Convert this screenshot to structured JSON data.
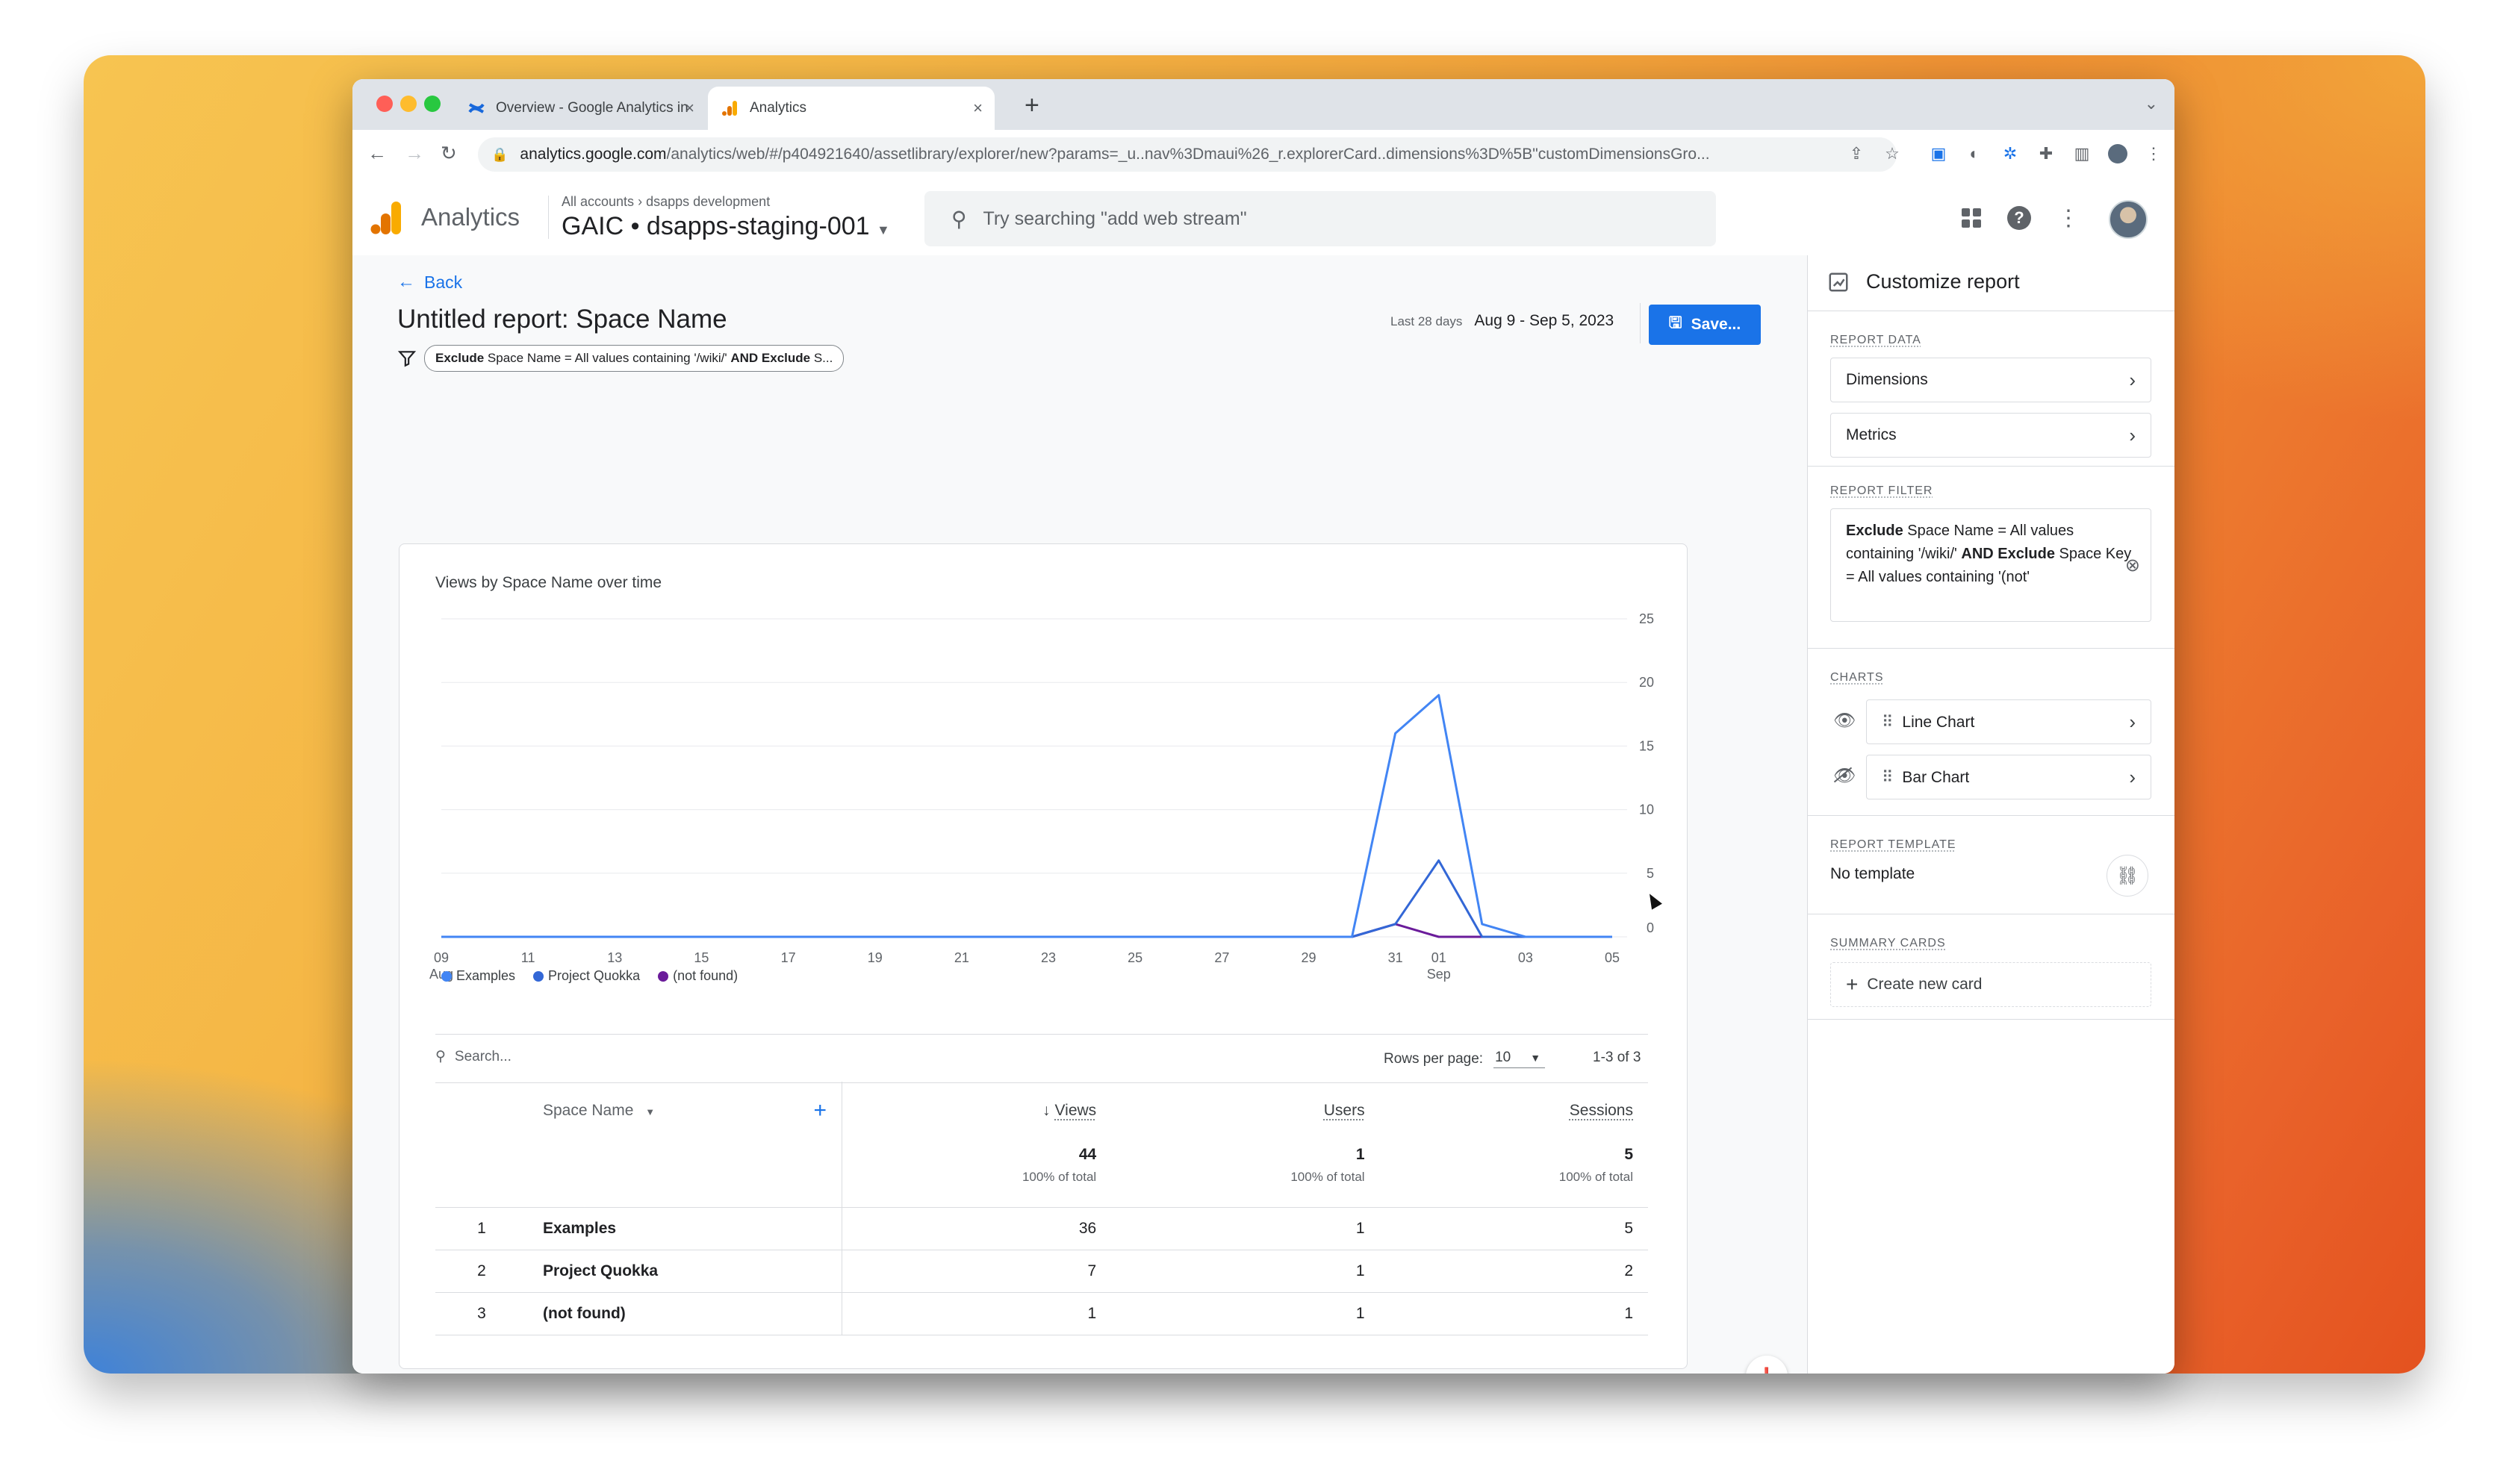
{
  "browser": {
    "tabs": [
      {
        "title": "Overview - Google Analytics in",
        "active": false
      },
      {
        "title": "Analytics",
        "active": true
      }
    ],
    "url_host": "analytics.google.com",
    "url_path": "/analytics/web/#/p404921640/assetlibrary/explorer/new?params=_u..nav%3Dmaui%26_r.explorerCard..dimensions%3D%5B\"customDimensionsGro..."
  },
  "header": {
    "app_name": "Analytics",
    "breadcrumb_root": "All accounts",
    "breadcrumb_account": "dsapps development",
    "property": "GAIC • dsapps-staging-001",
    "search_placeholder": "Try searching \"add web stream\""
  },
  "report": {
    "back_label": "Back",
    "title": "Untitled report: Space Name",
    "filter_chip": {
      "b1": "Exclude",
      "t1": " Space Name = All values containing '/wiki/' ",
      "b2": "AND Exclude",
      "t2": " S..."
    },
    "date_label": "Last 28 days",
    "date_value": "Aug 9 - Sep 5, 2023",
    "save_label": "Save..."
  },
  "chart_data": {
    "type": "line",
    "title": "Views by Space Name over time",
    "x": [
      "Aug 9",
      "Aug 10",
      "Aug 11",
      "Aug 12",
      "Aug 13",
      "Aug 14",
      "Aug 15",
      "Aug 16",
      "Aug 17",
      "Aug 18",
      "Aug 19",
      "Aug 20",
      "Aug 21",
      "Aug 22",
      "Aug 23",
      "Aug 24",
      "Aug 25",
      "Aug 26",
      "Aug 27",
      "Aug 28",
      "Aug 29",
      "Aug 30",
      "Aug 31",
      "Sep 1",
      "Sep 2",
      "Sep 3",
      "Sep 4",
      "Sep 5"
    ],
    "x_tick_labels": [
      "09",
      "11",
      "13",
      "15",
      "17",
      "19",
      "21",
      "23",
      "25",
      "27",
      "29",
      "31",
      "01",
      "03",
      "05"
    ],
    "x_tick_sublabels": {
      "09": "Aug",
      "01": "Sep"
    },
    "y_ticks": [
      0,
      5,
      10,
      15,
      20,
      25
    ],
    "ylim": [
      0,
      25
    ],
    "y_axis_side": "right",
    "grid": true,
    "legend_position": "bottom-left",
    "series": [
      {
        "name": "Examples",
        "color": "#4285f4",
        "values": [
          0,
          0,
          0,
          0,
          0,
          0,
          0,
          0,
          0,
          0,
          0,
          0,
          0,
          0,
          0,
          0,
          0,
          0,
          0,
          0,
          0,
          0,
          16,
          19,
          1,
          0,
          0,
          0
        ]
      },
      {
        "name": "Project Quokka",
        "color": "#3367d6",
        "values": [
          0,
          0,
          0,
          0,
          0,
          0,
          0,
          0,
          0,
          0,
          0,
          0,
          0,
          0,
          0,
          0,
          0,
          0,
          0,
          0,
          0,
          0,
          1,
          6,
          0,
          0,
          0,
          0
        ]
      },
      {
        "name": "(not found)",
        "color": "#6a1b9a",
        "values": [
          0,
          0,
          0,
          0,
          0,
          0,
          0,
          0,
          0,
          0,
          0,
          0,
          0,
          0,
          0,
          0,
          0,
          0,
          0,
          0,
          0,
          0,
          1,
          0,
          0,
          0,
          0,
          0
        ]
      }
    ]
  },
  "table": {
    "search_placeholder": "Search...",
    "rows_per_page_label": "Rows per page:",
    "rows_per_page": "10",
    "pagination": "1-3 of 3",
    "dimension_header": "Space Name",
    "columns": [
      "Views",
      "Users",
      "Sessions"
    ],
    "totals": [
      "44",
      "1",
      "5"
    ],
    "totals_sub": "100% of total",
    "rows": [
      {
        "idx": "1",
        "name": "Examples",
        "views": "36",
        "users": "1",
        "sessions": "5"
      },
      {
        "idx": "2",
        "name": "Project Quokka",
        "views": "7",
        "users": "1",
        "sessions": "2"
      },
      {
        "idx": "3",
        "name": "(not found)",
        "views": "1",
        "users": "1",
        "sessions": "1"
      }
    ]
  },
  "panel": {
    "title": "Customize report",
    "report_data_label": "REPORT DATA",
    "dimensions": "Dimensions",
    "metrics": "Metrics",
    "report_filter_label": "REPORT FILTER",
    "filter": {
      "b1": "Exclude",
      "t1": " Space Name = All values containing '/wiki/' ",
      "b2": "AND Exclude",
      "t2": " Space Key = All values containing '(not'"
    },
    "charts_label": "CHARTS",
    "line_chart": "Line Chart",
    "bar_chart": "Bar Chart",
    "template_label": "REPORT TEMPLATE",
    "template_value": "No template",
    "summary_label": "SUMMARY CARDS",
    "create_card": "Create new card"
  }
}
